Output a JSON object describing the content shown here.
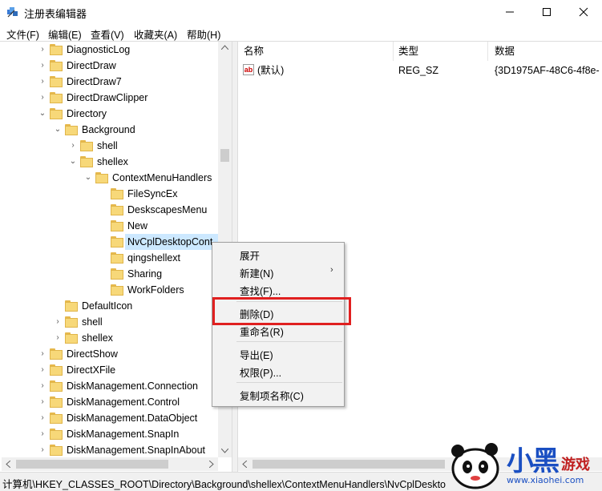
{
  "window": {
    "title": "注册表编辑器"
  },
  "menubar": [
    "文件(F)",
    "编辑(E)",
    "查看(V)",
    "收藏夹(A)",
    "帮助(H)"
  ],
  "tree": [
    {
      "label": "DiagnosticLog",
      "indent": 0,
      "expander": "collapsed"
    },
    {
      "label": "DirectDraw",
      "indent": 0,
      "expander": "collapsed"
    },
    {
      "label": "DirectDraw7",
      "indent": 0,
      "expander": "collapsed"
    },
    {
      "label": "DirectDrawClipper",
      "indent": 0,
      "expander": "collapsed"
    },
    {
      "label": "Directory",
      "indent": 0,
      "expander": "expanded"
    },
    {
      "label": "Background",
      "indent": 1,
      "expander": "expanded"
    },
    {
      "label": "shell",
      "indent": 2,
      "expander": "collapsed"
    },
    {
      "label": "shellex",
      "indent": 2,
      "expander": "expanded"
    },
    {
      "label": "ContextMenuHandlers",
      "indent": 3,
      "expander": "expanded"
    },
    {
      "label": "FileSyncEx",
      "indent": 4,
      "expander": "none"
    },
    {
      "label": "DeskscapesMenu",
      "indent": 4,
      "expander": "none"
    },
    {
      "label": "New",
      "indent": 4,
      "expander": "none"
    },
    {
      "label": "NvCplDesktopCont",
      "indent": 4,
      "expander": "none",
      "selected": true
    },
    {
      "label": "qingshellext",
      "indent": 4,
      "expander": "none"
    },
    {
      "label": "Sharing",
      "indent": 4,
      "expander": "none"
    },
    {
      "label": "WorkFolders",
      "indent": 4,
      "expander": "none"
    },
    {
      "label": "DefaultIcon",
      "indent": 1,
      "expander": "none"
    },
    {
      "label": "shell",
      "indent": 1,
      "expander": "collapsed"
    },
    {
      "label": "shellex",
      "indent": 1,
      "expander": "collapsed"
    },
    {
      "label": "DirectShow",
      "indent": 0,
      "expander": "collapsed"
    },
    {
      "label": "DirectXFile",
      "indent": 0,
      "expander": "collapsed"
    },
    {
      "label": "DiskManagement.Connection",
      "indent": 0,
      "expander": "collapsed"
    },
    {
      "label": "DiskManagement.Control",
      "indent": 0,
      "expander": "collapsed"
    },
    {
      "label": "DiskManagement.DataObject",
      "indent": 0,
      "expander": "collapsed"
    },
    {
      "label": "DiskManagement.SnapIn",
      "indent": 0,
      "expander": "collapsed"
    },
    {
      "label": "DiskManagement.SnapInAbout",
      "indent": 0,
      "expander": "collapsed"
    }
  ],
  "list": {
    "columns": [
      "名称",
      "类型",
      "数据"
    ],
    "rows": [
      {
        "name": "(默认)",
        "type": "REG_SZ",
        "data": "{3D1975AF-48C6-4f8e-"
      }
    ]
  },
  "context_menu": {
    "expand": "展开",
    "new": "新建(N)",
    "find": "查找(F)...",
    "delete": "删除(D)",
    "rename": "重命名(R)",
    "export": "导出(E)",
    "permissions": "权限(P)...",
    "copy_key_name": "复制项名称(C)"
  },
  "statusbar": {
    "path": "计算机\\HKEY_CLASSES_ROOT\\Directory\\Background\\shellex\\ContextMenuHandlers\\NvCplDeskto"
  },
  "watermark": {
    "logo_text": "小黑",
    "logo_sub": "游戏",
    "url": "www.xiaohei.com"
  },
  "colors": {
    "selection": "#cce8ff",
    "highlight_border": "#e02020",
    "folder": "#f7d879"
  }
}
